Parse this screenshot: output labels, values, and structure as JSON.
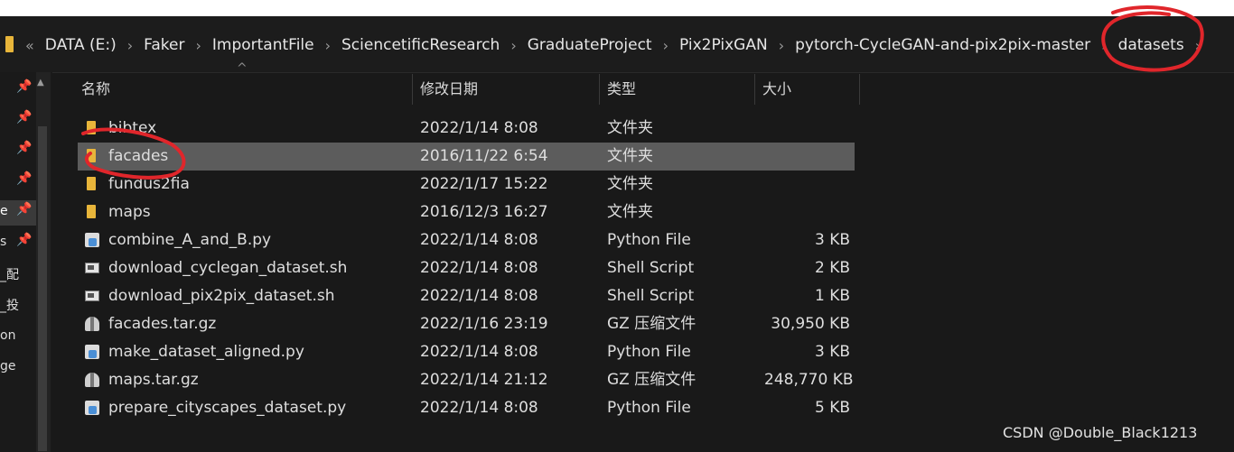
{
  "address": {
    "crumbs": [
      "DATA (E:)",
      "Faker",
      "ImportantFile",
      "SciencetificResearch",
      "GraduateProject",
      "Pix2PixGAN",
      "pytorch-CycleGAN-and-pix2pix-master",
      "datasets"
    ],
    "lead_separator": "«",
    "separator": "›"
  },
  "nav": {
    "items": [
      {
        "label": "",
        "pin": "📌"
      },
      {
        "label": "",
        "pin": "📌"
      },
      {
        "label": "",
        "pin": "📌"
      },
      {
        "label": "",
        "pin": "📌"
      },
      {
        "label": "e",
        "pin": "📌"
      },
      {
        "label": "s",
        "pin": "📌"
      },
      {
        "label": "_配",
        "pin": ""
      },
      {
        "label": "_投",
        "pin": ""
      },
      {
        "label": "on",
        "pin": ""
      },
      {
        "label": "ge",
        "pin": ""
      }
    ],
    "selected_index": 4
  },
  "columns": {
    "name": "名称",
    "date": "修改日期",
    "type": "类型",
    "size": "大小"
  },
  "files": [
    {
      "icon": "folder-icon",
      "name": "bibtex",
      "date": "2022/1/14 8:08",
      "type": "文件夹",
      "size": ""
    },
    {
      "icon": "folder-icon",
      "name": "facades",
      "date": "2016/11/22 6:54",
      "type": "文件夹",
      "size": "",
      "selected": true
    },
    {
      "icon": "folder-icon",
      "name": "fundus2fia",
      "date": "2022/1/17 15:22",
      "type": "文件夹",
      "size": ""
    },
    {
      "icon": "folder-icon",
      "name": "maps",
      "date": "2016/12/3 16:27",
      "type": "文件夹",
      "size": ""
    },
    {
      "icon": "python-file-icon",
      "name": "combine_A_and_B.py",
      "date": "2022/1/14 8:08",
      "type": "Python File",
      "size": "3 KB"
    },
    {
      "icon": "shell-script-icon",
      "name": "download_cyclegan_dataset.sh",
      "date": "2022/1/14 8:08",
      "type": "Shell Script",
      "size": "2 KB"
    },
    {
      "icon": "shell-script-icon",
      "name": "download_pix2pix_dataset.sh",
      "date": "2022/1/14 8:08",
      "type": "Shell Script",
      "size": "1 KB"
    },
    {
      "icon": "archive-icon",
      "name": "facades.tar.gz",
      "date": "2022/1/16 23:19",
      "type": "GZ 压缩文件",
      "size": "30,950 KB"
    },
    {
      "icon": "python-file-icon",
      "name": "make_dataset_aligned.py",
      "date": "2022/1/14 8:08",
      "type": "Python File",
      "size": "3 KB"
    },
    {
      "icon": "archive-icon",
      "name": "maps.tar.gz",
      "date": "2022/1/14 21:12",
      "type": "GZ 压缩文件",
      "size": "248,770 KB"
    },
    {
      "icon": "python-file-icon",
      "name": "prepare_cityscapes_dataset.py",
      "date": "2022/1/14 8:08",
      "type": "Python File",
      "size": "5 KB"
    }
  ],
  "watermark": "CSDN @Double_Black1213",
  "colors": {
    "background": "#191919",
    "selected_row": "#5c5c5c",
    "folder": "#e8b53a",
    "annotation": "#e0262b"
  }
}
